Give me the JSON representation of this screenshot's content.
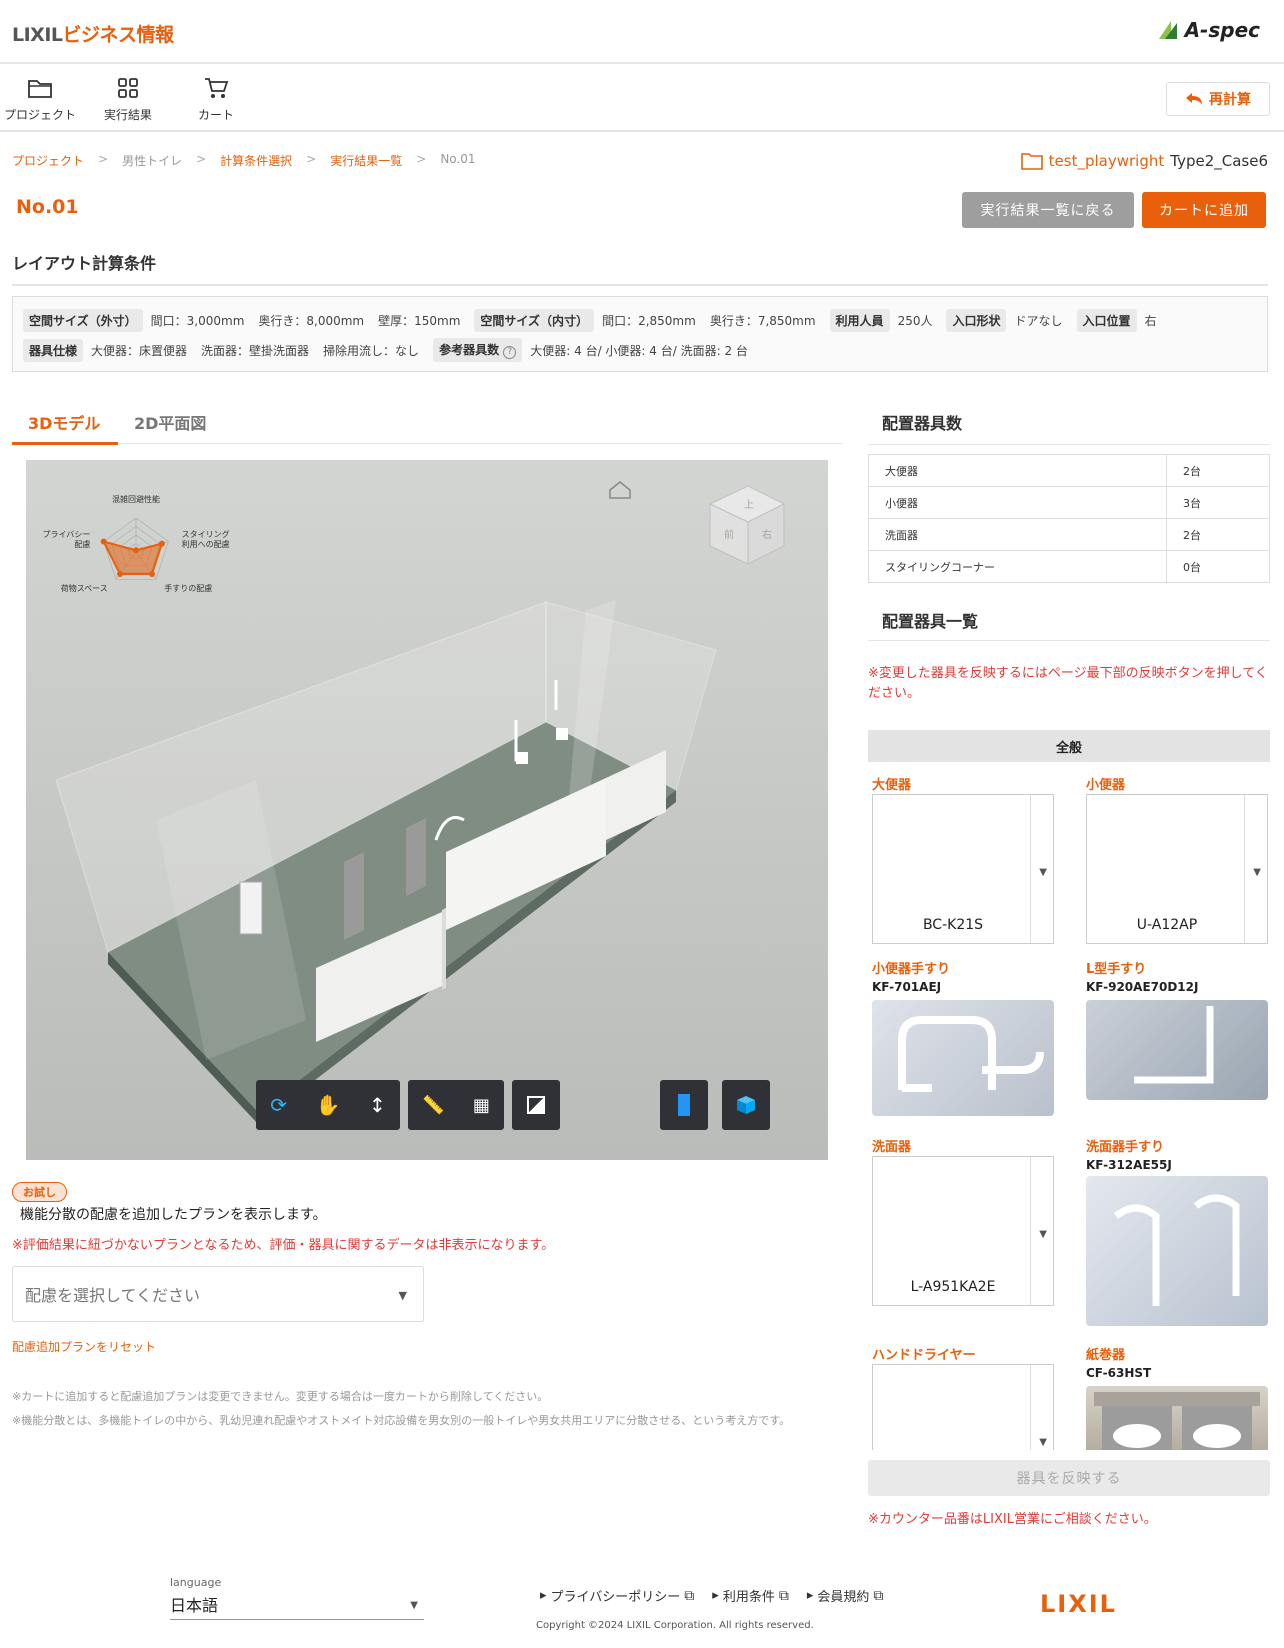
{
  "header": {
    "brand_lixil": "LIXIL",
    "brand_biz": "ビジネス情報",
    "aspec": "A-spec"
  },
  "toolbar": {
    "project": "プロジェクト",
    "results": "実行結果",
    "cart": "カート",
    "recalc": "再計算"
  },
  "breadcrumb": [
    "プロジェクト",
    "男性トイレ",
    "計算条件選択",
    "実行結果一覧",
    "No.01"
  ],
  "project_info": {
    "name": "test_playwright",
    "case": "Type2_Case6"
  },
  "page": {
    "title": "No.01",
    "back_button": "実行結果一覧に戻る",
    "add_cart_button": "カートに追加",
    "section_title": "レイアウト計算条件"
  },
  "conditions": {
    "outer_label": "空間サイズ（外寸）",
    "outer_frontage": "間口：3,000mm",
    "outer_depth": "奥行き：8,000mm",
    "wall": "壁厚：150mm",
    "inner_label": "空間サイズ（内寸）",
    "inner_frontage": "間口：2,850mm",
    "inner_depth": "奥行き：7,850mm",
    "users_label": "利用人員",
    "users": "250人",
    "entrance_shape_label": "入口形状",
    "entrance_shape": "ドアなし",
    "entrance_pos_label": "入口位置",
    "entrance_pos": "右",
    "spec_label": "器具仕様",
    "spec_toilet": "大便器：床置便器",
    "spec_basin": "洗面器：壁掛洗面器",
    "spec_sink": "掃除用流し：なし",
    "ref_label": "参考器具数",
    "ref_value": "大便器: 4 台/ 小便器: 4 台/ 洗面器: 2 台"
  },
  "tabs": [
    "3Dモデル",
    "2D平面図"
  ],
  "radar": {
    "labels": [
      "混雑回避性能",
      "スタイリング\n利用への配慮",
      "手すりの配慮",
      "荷物スペース",
      "プライバシー\n配慮"
    ],
    "values": [
      0.05,
      0.8,
      0.8,
      0.8,
      1.0
    ]
  },
  "viewer": {
    "cube_faces": [
      "上",
      "前",
      "右"
    ]
  },
  "placement": {
    "title": "配置器具数",
    "rows": [
      {
        "name": "大便器",
        "count": "2台"
      },
      {
        "name": "小便器",
        "count": "3台"
      },
      {
        "name": "洗面器",
        "count": "2台"
      },
      {
        "name": "スタイリングコーナー",
        "count": "0台"
      }
    ]
  },
  "fixtures": {
    "title": "配置器具一覧",
    "warning": "※変更した器具を反映するにはページ最下部の反映ボタンを押してください。",
    "category": "全般",
    "toilet": {
      "label": "大便器",
      "value": "BC-K21S"
    },
    "urinal": {
      "label": "小便器",
      "value": "U-A12AP"
    },
    "urinal_rail": {
      "label": "小便器手すり",
      "code": "KF-701AEJ"
    },
    "l_rail": {
      "label": "L型手すり",
      "code": "KF-920AE70D12J"
    },
    "basin": {
      "label": "洗面器",
      "value": "L-A951KA2E"
    },
    "basin_rail": {
      "label": "洗面器手すり",
      "code": "KF-312AE55J"
    },
    "dryer": {
      "label": "ハンドドライヤー",
      "value": ""
    },
    "paper": {
      "label": "紙巻器",
      "code": "CF-63HST"
    },
    "reflect_button": "器具を反映する",
    "counter_note": "※カウンター品番はLIXIL営業にご相談ください。"
  },
  "trial": {
    "badge": "お試し",
    "desc": "機能分散の配慮を追加したプランを表示します。",
    "warning": "※評価結果に紐づかないプランとなるため、評価・器具に関するデータは非表示になります。",
    "select_placeholder": "配慮を選択してください",
    "reset": "配慮追加プランをリセット",
    "note1": "※カートに追加すると配慮追加プランは変更できません。変更する場合は一度カートから削除してください。",
    "note2": "※機能分散とは、多機能トイレの中から、乳幼児連れ配慮やオストメイト対応設備を男女別の一般トイレや男女共用エリアに分散させる、という考え方です。"
  },
  "footer": {
    "language_label": "language",
    "language": "日本語",
    "links": [
      "プライバシーポリシー",
      "利用条件",
      "会員規約"
    ],
    "copyright": "Copyright ©2024 LIXIL Corporation. All rights reserved.",
    "logo": "LIXIL"
  },
  "colors": {
    "accent": "#e8600c",
    "warning": "#e53935",
    "toolbar_dark": "#2f3136",
    "toolbar_icon_blue": "#2196f3"
  }
}
